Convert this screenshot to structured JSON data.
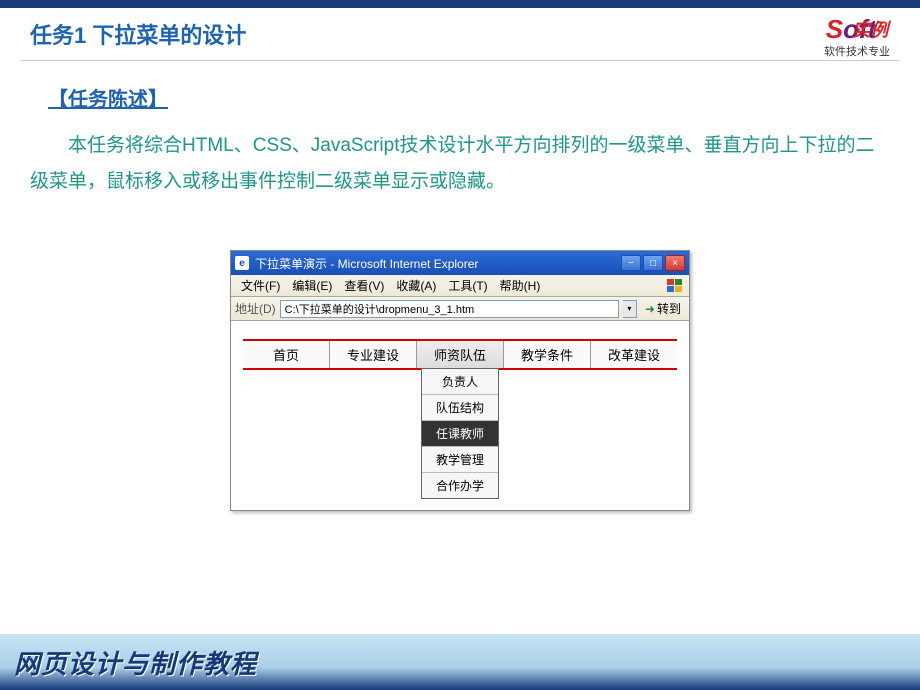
{
  "header": {
    "title": "任务1  下拉菜单的设计",
    "logo_overlay": "实例",
    "logo_sub": "软件技术专业"
  },
  "section": {
    "heading": "【任务陈述】",
    "body": "本任务将综合HTML、CSS、JavaScript技术设计水平方向排列的一级菜单、垂直方向上下拉的二级菜单，鼠标移入或移出事件控制二级菜单显示或隐藏。"
  },
  "ie": {
    "title": "下拉菜单演示 - Microsoft Internet Explorer",
    "menus": {
      "file": "文件(F)",
      "edit": "编辑(E)",
      "view": "查看(V)",
      "fav": "收藏(A)",
      "tools": "工具(T)",
      "help": "帮助(H)"
    },
    "addr_label": "地址(D)",
    "addr_value": "C:\\下拉菜单的设计\\dropmenu_3_1.htm",
    "go_label": "转到"
  },
  "main_menu": {
    "items": [
      "首页",
      "专业建设",
      "师资队伍",
      "教学条件",
      "改革建设"
    ],
    "submenu": [
      "负责人",
      "队伍结构",
      "任课教师",
      "教学管理",
      "合作办学"
    ]
  },
  "footer": {
    "text": "网页设计与制作教程"
  }
}
